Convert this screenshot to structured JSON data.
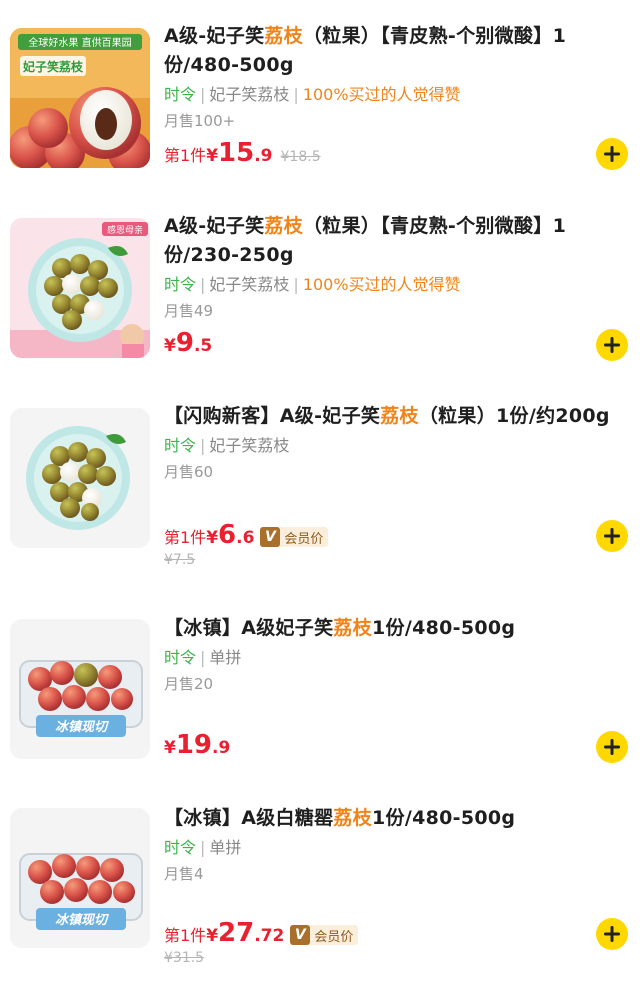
{
  "products": [
    {
      "title_pre": "A级-妃子笑",
      "title_hl": "荔枝",
      "title_post": "（粒果）【青皮熟-个别微酸】1份/480-500g",
      "tag_season": "时令",
      "tag_variety": "妃子笑荔枝",
      "tag_praise": "100%买过的人觉得赞",
      "sold": "月售100+",
      "first_label": "第1件",
      "yen": "¥",
      "price_int": "15",
      "price_dec": ".9",
      "orig_price": "¥18.5",
      "image": "lychee-promo-banner",
      "image_text_1": "全球好水果 直供百果园",
      "image_text_2": "妃子笑荔枝"
    },
    {
      "title_pre": "A级-妃子笑",
      "title_hl": "荔枝",
      "title_post": "（粒果）【青皮熟-个别微酸】1份/230-250g",
      "tag_season": "时令",
      "tag_variety": "妃子笑荔枝",
      "tag_praise": "100%买过的人觉得赞",
      "sold": "月售49",
      "yen": "¥",
      "price_int": "9",
      "price_dec": ".5",
      "image": "lychee-plate-mothers-day",
      "image_badge": "感恩母亲"
    },
    {
      "title_pre": "【闪购新客】A级-妃子笑",
      "title_hl": "荔枝",
      "title_post": "（粒果）1份/约200g",
      "tag_season": "时令",
      "tag_variety": "妃子笑荔枝",
      "sold": "月售60",
      "first_label": "第1件",
      "yen": "¥",
      "price_int": "6",
      "price_dec": ".6",
      "vip_label": "会员价",
      "orig_price": "¥7.5",
      "image": "lychee-plate"
    },
    {
      "title_pre": "【冰镇】A级妃子笑",
      "title_hl": "荔枝",
      "title_post": "1份/480-500g",
      "tag_season": "时令",
      "tag_variety": "单拼",
      "sold": "月售20",
      "yen": "¥",
      "price_int": "19",
      "price_dec": ".9",
      "image": "lychee-ice-box",
      "image_text": "冰镇现切"
    },
    {
      "title_pre": "【冰镇】A级白糖罂",
      "title_hl": "荔枝",
      "title_post": "1份/480-500g",
      "tag_season": "时令",
      "tag_variety": "单拼",
      "sold": "月售4",
      "first_label": "第1件",
      "yen": "¥",
      "price_int": "27",
      "price_dec": ".72",
      "vip_label": "会员价",
      "orig_price": "¥31.5",
      "image": "lychee-ice-box",
      "image_text": "冰镇现切"
    }
  ],
  "icons": {
    "add": "plus-icon",
    "vip": "v-badge-icon"
  },
  "colors": {
    "accent": "#ffd800",
    "price": "#e8202f",
    "highlight": "#f0841a",
    "season": "#3bb54a",
    "vip": "#a8702a"
  }
}
